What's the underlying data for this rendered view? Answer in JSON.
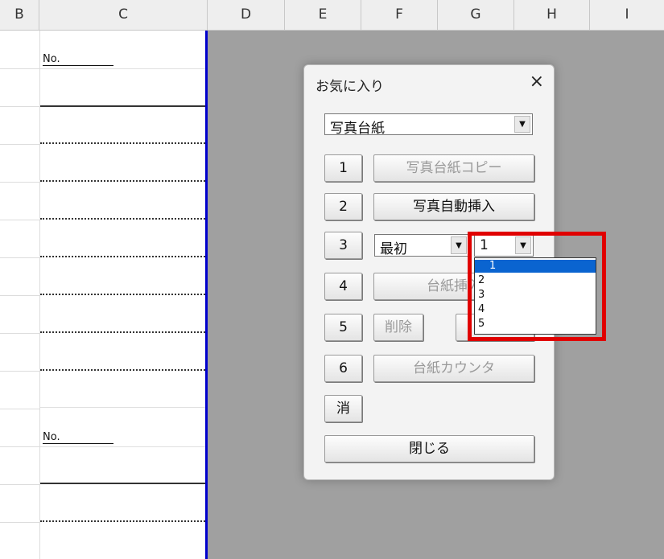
{
  "columns": [
    "B",
    "C",
    "D",
    "E",
    "F",
    "G",
    "H",
    "I"
  ],
  "sheet": {
    "no_label": "No."
  },
  "dialog": {
    "title": "お気に入り",
    "close_icon": "×",
    "combo_value": "写真台紙",
    "buttons": [
      {
        "num": "1",
        "action": "写真台紙コピー"
      },
      {
        "num": "2",
        "action": "写真自動挿入"
      },
      {
        "num": "3",
        "first_combo": "最初",
        "second_combo": "1"
      },
      {
        "num": "4",
        "action": "台紙挿入"
      },
      {
        "num": "5",
        "action": "削除"
      },
      {
        "num": "6",
        "action": "台紙カウンタ"
      }
    ],
    "erase_label": "消",
    "close_label": "閉じる"
  },
  "dropdown": {
    "options": [
      "1",
      "2",
      "3",
      "4",
      "5"
    ],
    "selected": "1"
  }
}
